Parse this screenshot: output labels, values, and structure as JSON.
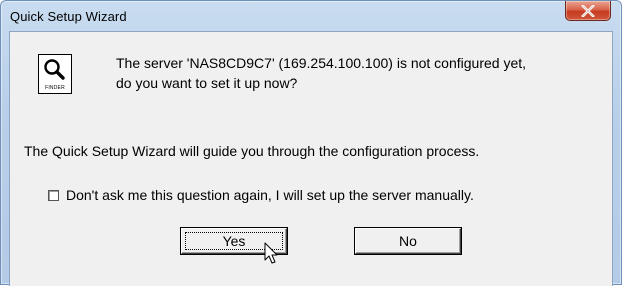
{
  "window": {
    "title": "Quick Setup Wizard"
  },
  "icons": {
    "finder": "finder-icon",
    "close": "close-icon",
    "cursor": "mouse-cursor-arrow"
  },
  "icon_label": "FINDER",
  "message": {
    "question_line1": "The server 'NAS8CD9C7' (169.254.100.100) is not configured yet,",
    "question_line2": "do you want to set it up now?",
    "info": "The Quick Setup Wizard will guide you through the configuration process."
  },
  "checkbox": {
    "label": "Don't ask me this question again, I will set up the server manually.",
    "checked": false
  },
  "buttons": {
    "yes": "Yes",
    "no": "No"
  },
  "colors": {
    "close_button": "#c9442a",
    "frame": "#b9d1ea",
    "client": "#f0f0f0"
  }
}
